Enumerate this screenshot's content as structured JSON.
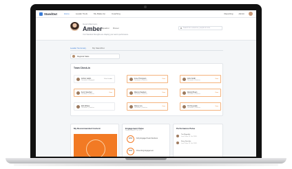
{
  "app": {
    "logo_text": "StandOut"
  },
  "nav": {
    "items": [
      "Home",
      "Leader Tools",
      "My Make-Up",
      "Coaching"
    ],
    "right": [
      "Reporting",
      "Admin"
    ]
  },
  "profile": {
    "subtitle": "Good Afternoon,",
    "name": "Amber",
    "meta": [
      "Equalizer",
      "Pioneer"
    ],
    "description": "Your Standout Strengths are shaping your team's performance",
    "search_placeholder": "Search for resources, people & more"
  },
  "tabs": [
    "Leader Summary",
    "My StandOut"
  ],
  "team_select": "Regional Sales",
  "checkin": {
    "title": "Team Check-in",
    "members": [
      {
        "name": "Amber Larkin",
        "role": "Teammate | Engaged",
        "action": "View Leader",
        "active": false
      },
      {
        "name": "Irene Thompson",
        "role": "Teammate | Check-in",
        "action": "View",
        "active": true
      },
      {
        "name": "John Smith",
        "role": "Teammate | Check-in",
        "action": "View",
        "active": true
      },
      {
        "name": "Kerry Sanchez",
        "role": "Teammate | Check-in",
        "action": "View",
        "active": true
      },
      {
        "name": "Marcus Sanders",
        "role": "Teammate | Check-in",
        "action": "View",
        "active": true
      },
      {
        "name": "Randy Brown",
        "role": "Teammate | Check-in",
        "action": "View",
        "active": true
      },
      {
        "name": "Rob Wilson",
        "role": "Teammate | Check-in",
        "action": "",
        "active": false
      },
      {
        "name": "Shane Lim",
        "role": "Teammate | Check-in",
        "action": "View",
        "active": true
      },
      {
        "name": "Tim Reynolds",
        "role": "Teammate | Check-in",
        "action": "View",
        "active": true
      }
    ]
  },
  "recommended": {
    "title": "My Recommended Content"
  },
  "engagement": {
    "title": "Engagement Pulse",
    "subtitle": "Survey closed 22 Oct 2019",
    "rows": [
      {
        "value": "22%",
        "label": "Fully Engaged Team Members"
      },
      {
        "value": "10%",
        "label": "Pulse Ring Engagement"
      }
    ]
  },
  "performance": {
    "title": "Performance Pulse",
    "rows": [
      {
        "name": "Tim Reynolds",
        "sub": "Last Pulse 22 Oct 2019"
      },
      {
        "name": "Kerry Sanchez",
        "sub": "Last Pulse 22 Oct 2019"
      }
    ]
  }
}
